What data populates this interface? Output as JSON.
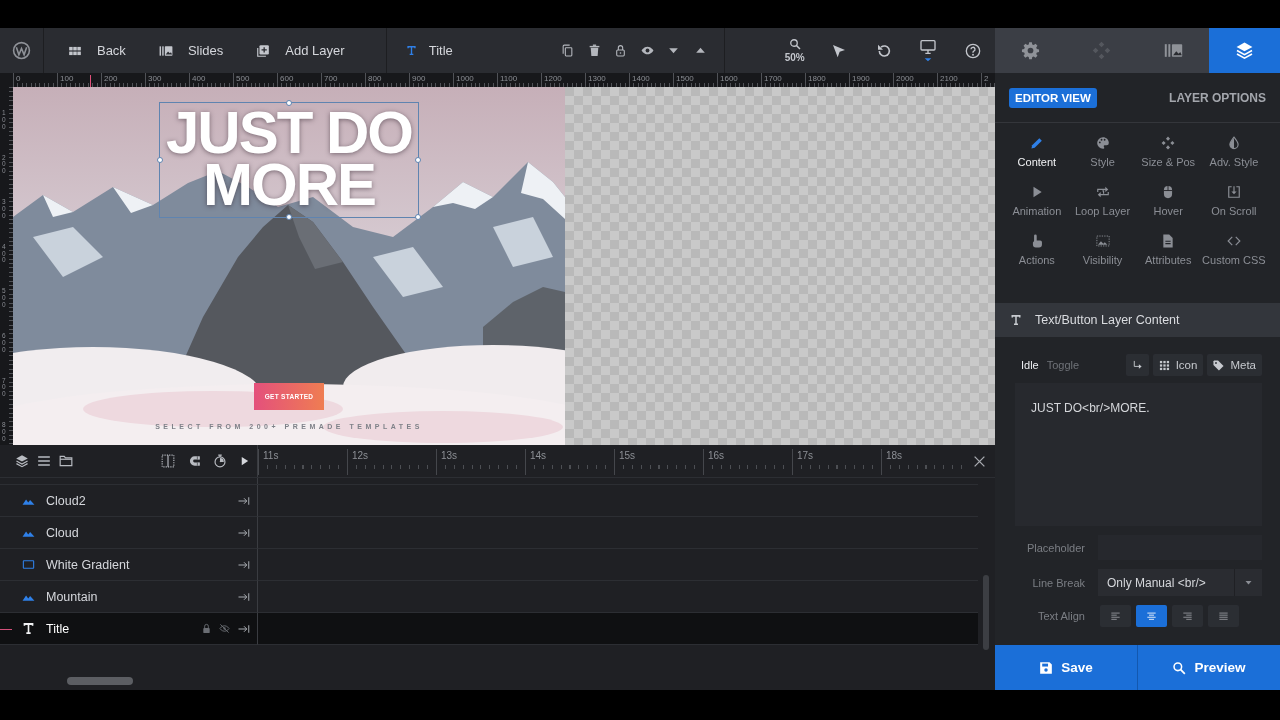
{
  "toolbar": {
    "nav": [
      {
        "label": "Back"
      },
      {
        "label": "Slides"
      },
      {
        "label": "Add Layer"
      }
    ],
    "layer": "Title",
    "zoom": "50%"
  },
  "panel_tabs": [
    {
      "selected": false,
      "disabled": false
    },
    {
      "selected": false,
      "disabled": true
    },
    {
      "selected": false,
      "disabled": false
    },
    {
      "selected": true,
      "disabled": false
    }
  ],
  "ruler": {
    "horizontal": [
      "0",
      "100",
      "200",
      "300",
      "400",
      "500",
      "600",
      "700",
      "800",
      "900",
      "1000",
      "1100",
      "1200",
      "1300",
      "1400",
      "1500",
      "1600",
      "1700",
      "1800",
      "1900",
      "2000",
      "2100",
      "2"
    ],
    "vertical": [
      "100",
      "200",
      "300",
      "400",
      "500",
      "600",
      "700",
      "800"
    ]
  },
  "canvas": {
    "title_lines": [
      "JUST DO",
      "MORE"
    ],
    "button": "GET STARTED",
    "tagline": "SELECT FROM 200+ PREMADE TEMPLATES"
  },
  "timeline": {
    "times": [
      "11s",
      "12s",
      "13s",
      "14s",
      "15s",
      "16s",
      "17s",
      "18s"
    ],
    "layers": [
      {
        "name": "Cloud2",
        "kind": "image",
        "selected": false
      },
      {
        "name": "Cloud",
        "kind": "image",
        "selected": false
      },
      {
        "name": "White Gradient",
        "kind": "shape",
        "selected": false
      },
      {
        "name": "Mountain",
        "kind": "image",
        "selected": false
      },
      {
        "name": "Title",
        "kind": "text",
        "selected": true
      }
    ]
  },
  "panel": {
    "badge": "EDITOR VIEW",
    "heading": "LAYER OPTIONS",
    "options": [
      {
        "label": "Content",
        "selected": true
      },
      {
        "label": "Style",
        "selected": false
      },
      {
        "label": "Size & Pos",
        "selected": false
      },
      {
        "label": "Adv. Style",
        "selected": false
      },
      {
        "label": "Animation",
        "selected": false
      },
      {
        "label": "Loop Layer",
        "selected": false
      },
      {
        "label": "Hover",
        "selected": false
      },
      {
        "label": "On Scroll",
        "selected": false
      },
      {
        "label": "Actions",
        "selected": false
      },
      {
        "label": "Visibility",
        "selected": false
      },
      {
        "label": "Attributes",
        "selected": false
      },
      {
        "label": "Custom CSS",
        "selected": false
      }
    ],
    "section": "Text/Button Layer Content",
    "modes": [
      {
        "label": "Idle",
        "selected": true
      },
      {
        "label": "Toggle",
        "selected": false
      }
    ],
    "actions": [
      {
        "label": "Icon"
      },
      {
        "label": "Meta"
      }
    ],
    "content": "JUST DO<br/>MORE.",
    "fields": [
      {
        "label": "Placeholder",
        "kind": "input"
      },
      {
        "label": "Line Break",
        "kind": "select",
        "value": "Only Manual <br/>"
      },
      {
        "label": "Text Align",
        "kind": "align",
        "options": [
          {
            "selected": false
          },
          {
            "selected": true
          },
          {
            "selected": false
          },
          {
            "selected": false
          }
        ]
      }
    ]
  },
  "footer": [
    {
      "label": "Save"
    },
    {
      "label": "Preview"
    }
  ]
}
